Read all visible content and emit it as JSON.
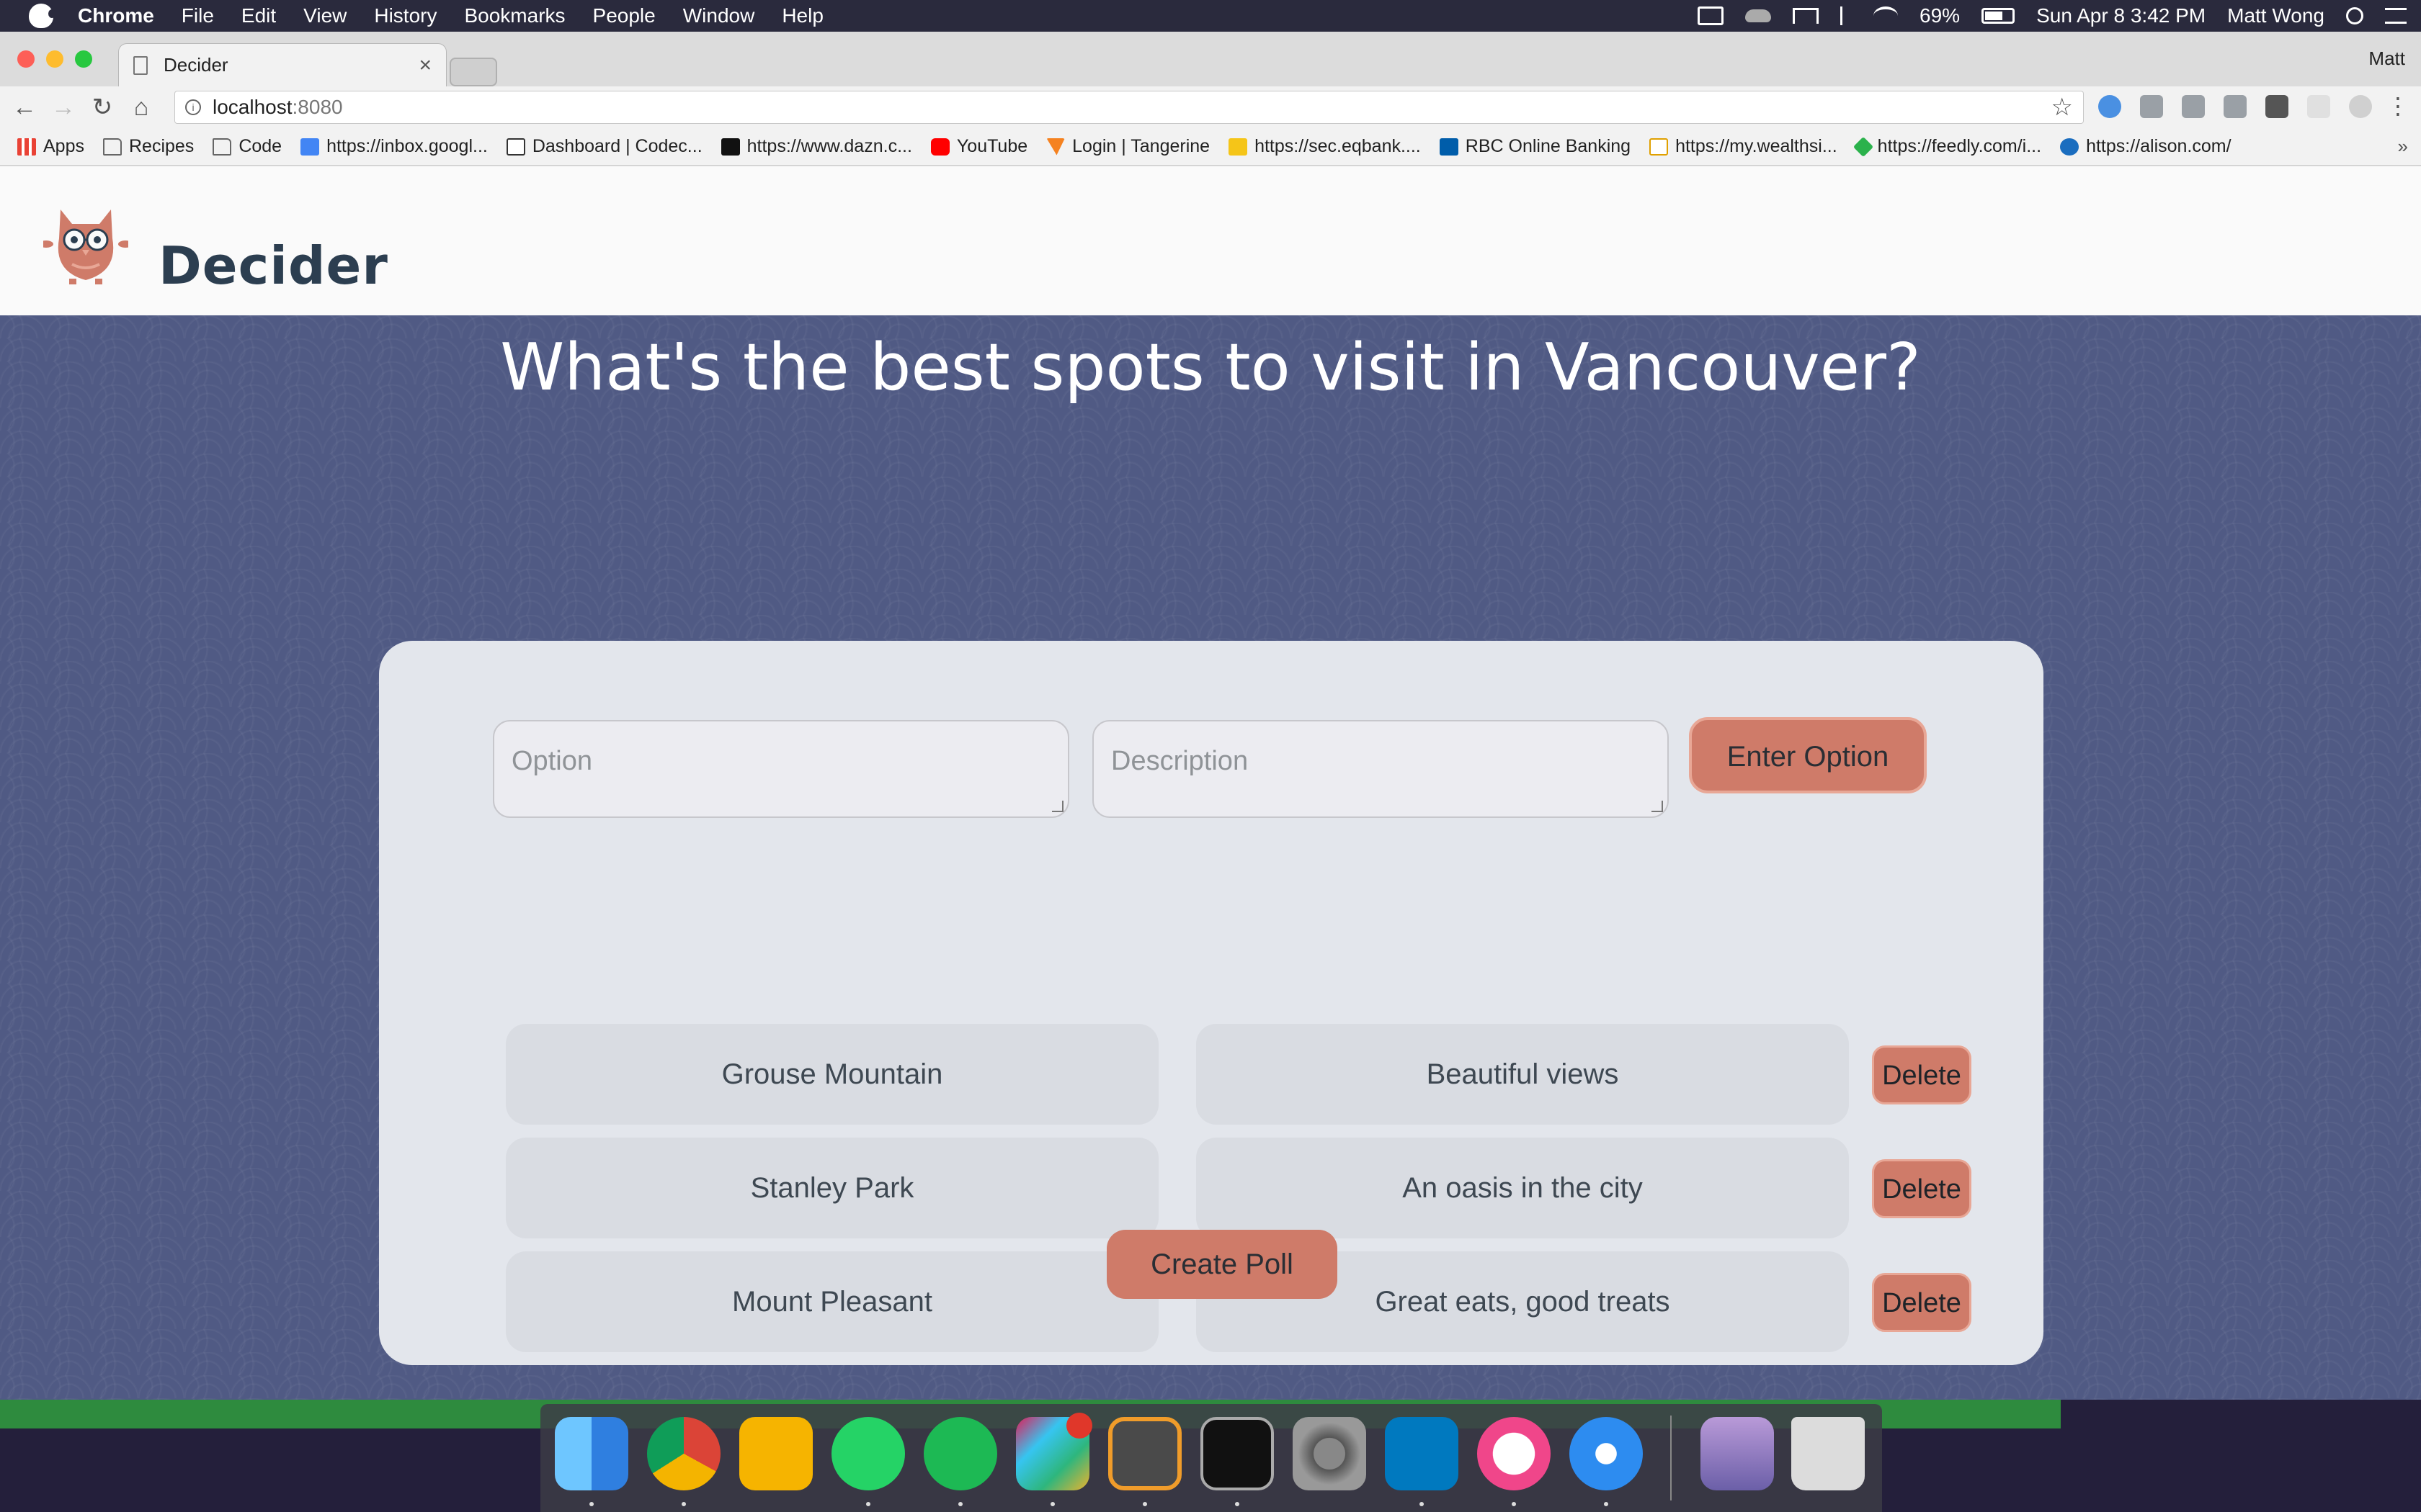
{
  "menubar": {
    "app": "Chrome",
    "items": [
      "File",
      "Edit",
      "View",
      "History",
      "Bookmarks",
      "People",
      "Window",
      "Help"
    ],
    "battery": "69%",
    "datetime": "Sun Apr 8  3:42 PM",
    "user": "Matt Wong"
  },
  "browser": {
    "tab_title": "Decider",
    "tab_close": "×",
    "profile": "Matt",
    "url_host": "localhost",
    "url_port": ":8080",
    "bookmarks": [
      {
        "label": "Apps",
        "icon": "apps-grid-icon"
      },
      {
        "label": "Recipes",
        "icon": "folder-icon"
      },
      {
        "label": "Code",
        "icon": "folder-icon"
      },
      {
        "label": "https://inbox.googl...",
        "icon": "inbox-icon"
      },
      {
        "label": "Dashboard | Codec...",
        "icon": "codecademy-icon"
      },
      {
        "label": "https://www.dazn.c...",
        "icon": "dazn-icon"
      },
      {
        "label": "YouTube",
        "icon": "youtube-icon"
      },
      {
        "label": "Login | Tangerine",
        "icon": "tangerine-icon"
      },
      {
        "label": "https://sec.eqbank....",
        "icon": "eqbank-icon"
      },
      {
        "label": "RBC Online Banking",
        "icon": "rbc-icon"
      },
      {
        "label": "https://my.wealthsi...",
        "icon": "wealthsimple-icon"
      },
      {
        "label": "https://feedly.com/i...",
        "icon": "feedly-icon"
      },
      {
        "label": "https://alison.com/",
        "icon": "alison-icon"
      }
    ],
    "more": "»"
  },
  "site": {
    "brand": "Decider",
    "question": "What's the best spots to visit in Vancouver?",
    "form": {
      "option_placeholder": "Option",
      "description_placeholder": "Description",
      "enter_label": "Enter Option"
    },
    "options": [
      {
        "name": "Grouse Mountain",
        "description": "Beautiful views",
        "delete_label": "Delete"
      },
      {
        "name": "Stanley Park",
        "description": "An oasis in the city",
        "delete_label": "Delete"
      },
      {
        "name": "Mount Pleasant",
        "description": "Great eats, good treats",
        "delete_label": "Delete"
      }
    ],
    "create_label": "Create Poll"
  },
  "dock": {
    "apps": [
      "finder-icon",
      "chrome-icon",
      "keep-icon",
      "whatsapp-icon",
      "spotify-icon",
      "slack-icon",
      "sublime-text-icon",
      "terminal-icon",
      "system-preferences-icon",
      "trello-icon",
      "itunes-icon",
      "safari-icon",
      "photos-stack-icon",
      "trash-icon"
    ]
  },
  "colors": {
    "accent": "#cf7b69",
    "page_bg": "#505a84",
    "card_bg": "#e3e6ec",
    "brand_text": "#2c3e50"
  }
}
